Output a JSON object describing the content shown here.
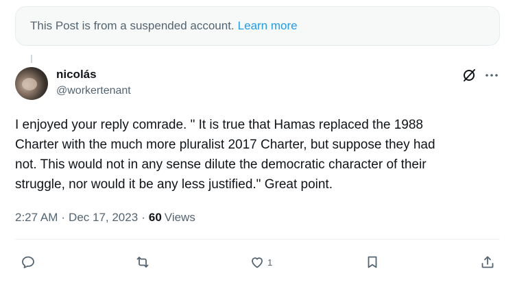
{
  "notice": {
    "text": "This Post is from a suspended account.",
    "link": "Learn more"
  },
  "post": {
    "author_name": "nicolás",
    "author_handle": "@workertenant",
    "body": "I enjoyed your reply comrade. \" It is true that Hamas replaced the 1988\nCharter with the much more pluralist 2017 Charter, but suppose they had\nnot. This would not in any sense dilute the democratic character of their\nstruggle, nor would it be any less justified.\" Great point.",
    "time": "2:27 AM",
    "date": "Dec 17, 2023",
    "views_count": "60",
    "views_label": "Views"
  },
  "actions": {
    "reply_icon": "reply-icon",
    "repost_icon": "repost-icon",
    "like_icon": "like-icon",
    "like_count": "1",
    "bookmark_icon": "bookmark-icon",
    "share_icon": "share-icon"
  },
  "colors": {
    "text_primary": "#0f1419",
    "text_secondary": "#536471",
    "link": "#1d9bf0",
    "notice_bg": "#f7f9f9"
  }
}
